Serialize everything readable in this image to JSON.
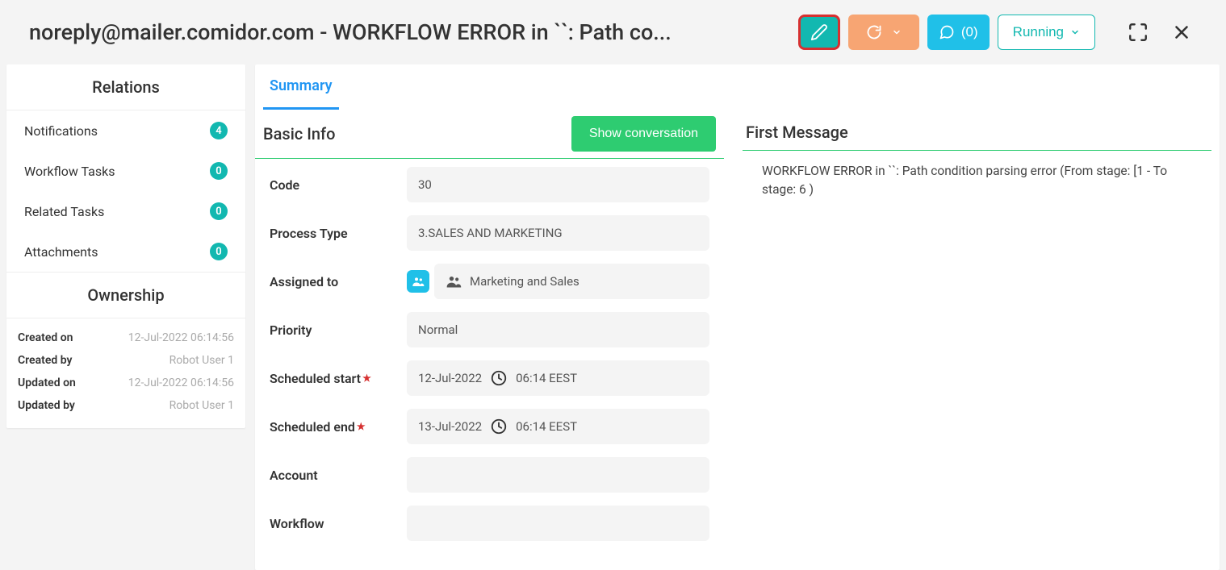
{
  "header": {
    "title": "noreply@mailer.comidor.com - WORKFLOW ERROR in ``: Path co...",
    "comments_label": "(0)",
    "status_label": "Running"
  },
  "sidebar": {
    "relations_title": "Relations",
    "items": [
      {
        "label": "Notifications",
        "count": "4"
      },
      {
        "label": "Workflow Tasks",
        "count": "0"
      },
      {
        "label": "Related Tasks",
        "count": "0"
      },
      {
        "label": "Attachments",
        "count": "0"
      }
    ],
    "ownership_title": "Ownership",
    "ownership": [
      {
        "label": "Created on",
        "value": "12-Jul-2022 06:14:56"
      },
      {
        "label": "Created by",
        "value": "Robot User 1"
      },
      {
        "label": "Updated on",
        "value": "12-Jul-2022 06:14:56"
      },
      {
        "label": "Updated by",
        "value": "Robot User 1"
      }
    ]
  },
  "tabs": {
    "summary": "Summary"
  },
  "basic_info": {
    "title": "Basic Info",
    "show_conversation": "Show conversation",
    "fields": {
      "code_label": "Code",
      "code_value": "30",
      "process_type_label": "Process Type",
      "process_type_value": "3.SALES AND MARKETING",
      "assigned_label": "Assigned to",
      "assigned_value": "Marketing and Sales",
      "priority_label": "Priority",
      "priority_value": "Normal",
      "sched_start_label": "Scheduled start",
      "sched_start_date": "12-Jul-2022",
      "sched_start_time": "06:14 EEST",
      "sched_end_label": "Scheduled end",
      "sched_end_date": "13-Jul-2022",
      "sched_end_time": "06:14 EEST",
      "account_label": "Account",
      "account_value": "",
      "workflow_label": "Workflow",
      "workflow_value": ""
    }
  },
  "first_message": {
    "title": "First Message",
    "body": "WORKFLOW ERROR in ``: Path condition parsing error (From stage: [1 - To stage: 6 )"
  }
}
